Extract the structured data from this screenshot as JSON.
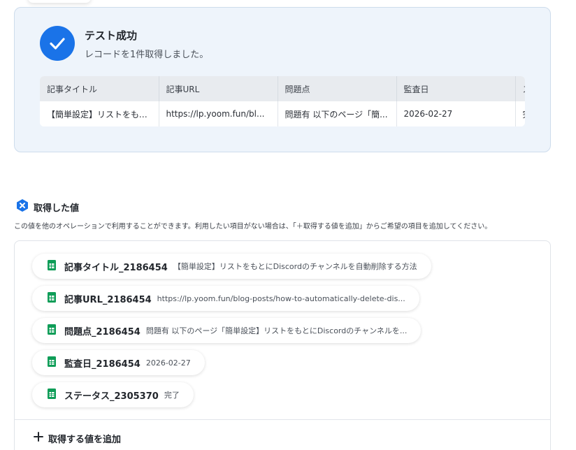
{
  "success": {
    "title": "テスト成功",
    "subtitle": "レコードを1件取得しました。"
  },
  "table": {
    "headers": [
      "記事タイトル",
      "記事URL",
      "問題点",
      "監査日",
      "ス"
    ],
    "row": [
      "【簡単設定】リストをもと...",
      "https://lp.yoom.fun/bl...",
      "問題有 以下のページ「簡...",
      "2026-02-27",
      "完"
    ]
  },
  "fetched": {
    "title": "取得した値",
    "description": "この値を他のオペレーションで利用することができます。利用したい項目がない場合は、「＋取得する値を追加」からご希望の項目を追加してください。",
    "items": [
      {
        "name": "記事タイトル_2186454",
        "value": "【簡単設定】リストをもとにDiscordのチャンネルを自動削除する方法"
      },
      {
        "name": "記事URL_2186454",
        "value": "https://lp.yoom.fun/blog-posts/how-to-automatically-delete-dis..."
      },
      {
        "name": "問題点_2186454",
        "value": "問題有 以下のページ「簡単設定】リストをもとにDiscordのチャンネルを..."
      },
      {
        "name": "監査日_2186454",
        "value": "2026-02-27"
      },
      {
        "name": "ステータス_2305370",
        "value": "完了"
      }
    ],
    "add_label": "取得する値を追加"
  },
  "icons": {
    "success": "check-circle-icon",
    "section": "x-hexagon-icon",
    "chip": "google-sheets-icon",
    "add": "plus-icon"
  },
  "colors": {
    "accent": "#1a73e8",
    "sheets_green": "#0f9d58",
    "card_bg": "#eef4fb"
  }
}
